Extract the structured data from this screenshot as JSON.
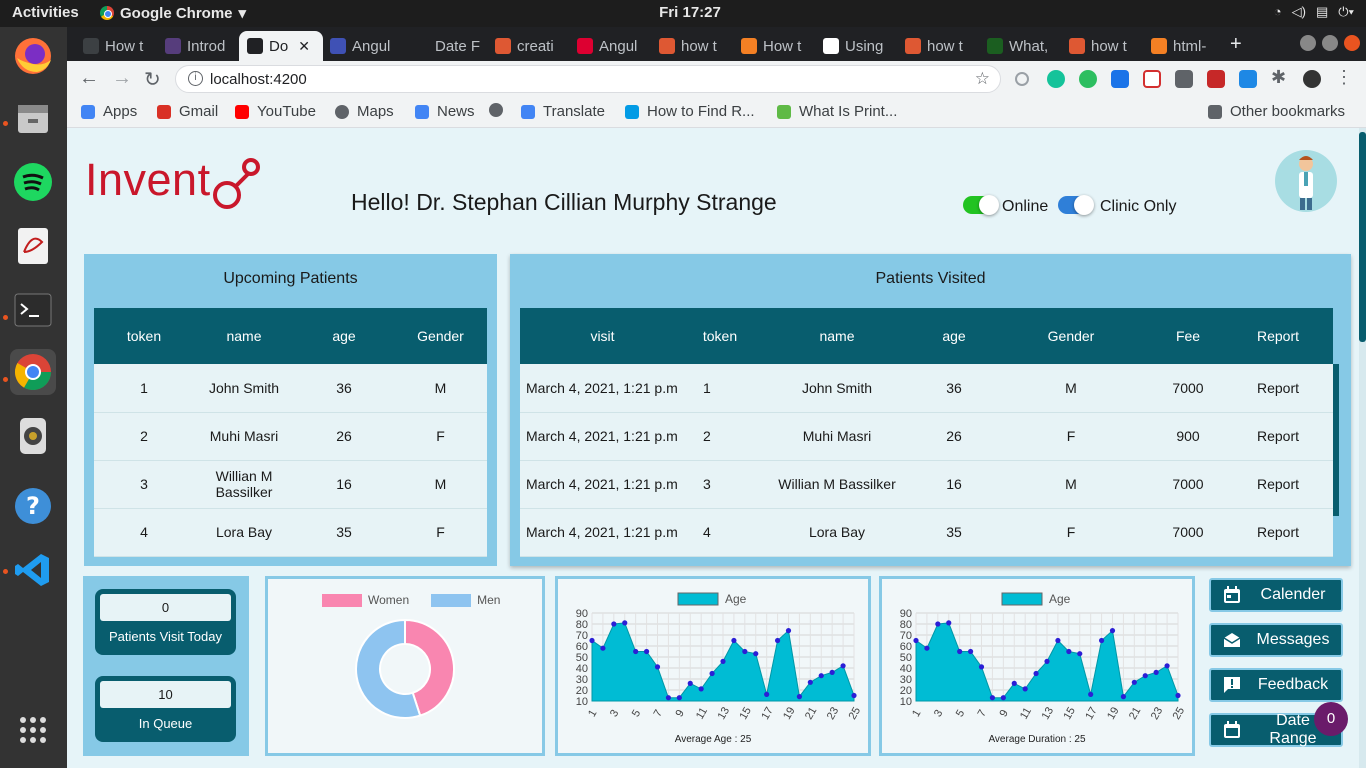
{
  "os": {
    "activities": "Activities",
    "app_name": "Google Chrome",
    "clock": "Fri 17:27"
  },
  "tabs": [
    {
      "label": "How t",
      "color": "#3c4043"
    },
    {
      "label": "Introd",
      "color": "#563d7c"
    },
    {
      "label": "Do",
      "color": "#202124",
      "active": true
    },
    {
      "label": "Angul",
      "color": "#3f51b5"
    },
    {
      "label": "Date F",
      "color": "#202124"
    },
    {
      "label": "creati",
      "color": "#de5833"
    },
    {
      "label": "Angul",
      "color": "#dd0031"
    },
    {
      "label": "how t",
      "color": "#de5833"
    },
    {
      "label": "How t",
      "color": "#f48024"
    },
    {
      "label": "Using",
      "color": "#ffffff"
    },
    {
      "label": "how t",
      "color": "#de5833"
    },
    {
      "label": "What,",
      "color": "#1b5e20"
    },
    {
      "label": "how t",
      "color": "#de5833"
    },
    {
      "label": "html-",
      "color": "#f48024"
    }
  ],
  "address_bar": {
    "url": "localhost:4200"
  },
  "bookmarks": [
    {
      "label": "Apps",
      "color": "#4285f4"
    },
    {
      "label": "Gmail",
      "color": "#d93025"
    },
    {
      "label": "YouTube",
      "color": "#ff0000"
    },
    {
      "label": "Maps",
      "color": "#5f6368"
    },
    {
      "label": "News",
      "color": "#4285f4"
    },
    {
      "label": "",
      "color": "#5f6368"
    },
    {
      "label": "Translate",
      "color": "#4285f4"
    },
    {
      "label": "How to Find R...",
      "color": "#039be5"
    },
    {
      "label": "What Is Print...",
      "color": "#5fba46"
    }
  ],
  "other_bookmarks": "Other bookmarks",
  "app": {
    "logo": "Invent",
    "greeting": "Hello! Dr. Stephan Cillian Murphy Strange",
    "toggles": [
      {
        "label": "Online",
        "on": true,
        "color": "#22c322"
      },
      {
        "label": "Clinic Only",
        "on": true,
        "color": "#2f7fd8"
      }
    ]
  },
  "upcoming": {
    "title": "Upcoming Patients",
    "columns": [
      "token",
      "name",
      "age",
      "Gender"
    ],
    "rows": [
      [
        "1",
        "John Smith",
        "36",
        "M"
      ],
      [
        "2",
        "Muhi Masri",
        "26",
        "F"
      ],
      [
        "3",
        "Willian M Bassilker",
        "16",
        "M"
      ],
      [
        "4",
        "Lora Bay",
        "35",
        "F"
      ]
    ]
  },
  "visited": {
    "title": "Patients Visited",
    "columns": [
      "visit",
      "token",
      "name",
      "age",
      "Gender",
      "Fee",
      "Report"
    ],
    "rows": [
      [
        "March 4, 2021, 1:21 p.m",
        "1",
        "John Smith",
        "36",
        "M",
        "7000",
        "Report"
      ],
      [
        "March 4, 2021, 1:21 p.m",
        "2",
        "Muhi Masri",
        "26",
        "F",
        "900",
        "Report"
      ],
      [
        "March 4, 2021, 1:21 p.m",
        "3",
        "Willian M Bassilker",
        "16",
        "M",
        "7000",
        "Report"
      ],
      [
        "March 4, 2021, 1:21 p.m",
        "4",
        "Lora Bay",
        "35",
        "F",
        "7000",
        "Report"
      ]
    ]
  },
  "stats": [
    {
      "value": "0",
      "label": "Patients Visit Today"
    },
    {
      "value": "10",
      "label": "In Queue"
    }
  ],
  "buttons": [
    {
      "label": "Calender",
      "icon": "calendar-icon"
    },
    {
      "label": "Messages",
      "icon": "envelope-icon"
    },
    {
      "label": "Feedback",
      "icon": "feedback-icon"
    },
    {
      "label": "Date Range",
      "icon": "calendar-icon"
    }
  ],
  "badge": "0",
  "colors": {
    "teal": "#085d6e",
    "panel": "#86c9e6",
    "women": "#f986b0",
    "men": "#8ec4f0",
    "area": "#00bcd4",
    "point": "#2b1fd6"
  },
  "chart_data": [
    {
      "type": "pie",
      "labels": [
        "Women",
        "Men"
      ],
      "values": [
        45,
        55
      ]
    },
    {
      "type": "area",
      "legend": "Age",
      "x": [
        1,
        2,
        3,
        4,
        5,
        6,
        7,
        8,
        9,
        10,
        11,
        12,
        13,
        14,
        15,
        16,
        17,
        18,
        19,
        20,
        21,
        22,
        23,
        24,
        25
      ],
      "xticks": [
        "1",
        "3",
        "5",
        "7",
        "9",
        "11",
        "13",
        "15",
        "17",
        "19",
        "21",
        "23",
        "25"
      ],
      "yticks": [
        "10",
        "20",
        "30",
        "40",
        "50",
        "60",
        "70",
        "80",
        "90"
      ],
      "ylim": [
        10,
        90
      ],
      "values": [
        65,
        58,
        80,
        81,
        55,
        55,
        41,
        13,
        13,
        26,
        21,
        35,
        46,
        65,
        55,
        53,
        16,
        65,
        74,
        14,
        27,
        33,
        36,
        42,
        15
      ],
      "footer": "Average Age : 25"
    },
    {
      "type": "area",
      "legend": "Age",
      "x": [
        1,
        2,
        3,
        4,
        5,
        6,
        7,
        8,
        9,
        10,
        11,
        12,
        13,
        14,
        15,
        16,
        17,
        18,
        19,
        20,
        21,
        22,
        23,
        24,
        25
      ],
      "xticks": [
        "1",
        "3",
        "5",
        "7",
        "9",
        "11",
        "13",
        "15",
        "17",
        "19",
        "21",
        "23",
        "25"
      ],
      "yticks": [
        "10",
        "20",
        "30",
        "40",
        "50",
        "60",
        "70",
        "80",
        "90"
      ],
      "ylim": [
        10,
        90
      ],
      "values": [
        65,
        58,
        80,
        81,
        55,
        55,
        41,
        13,
        13,
        26,
        21,
        35,
        46,
        65,
        55,
        53,
        16,
        65,
        74,
        14,
        27,
        33,
        36,
        42,
        15
      ],
      "footer": "Average Duration : 25"
    }
  ]
}
